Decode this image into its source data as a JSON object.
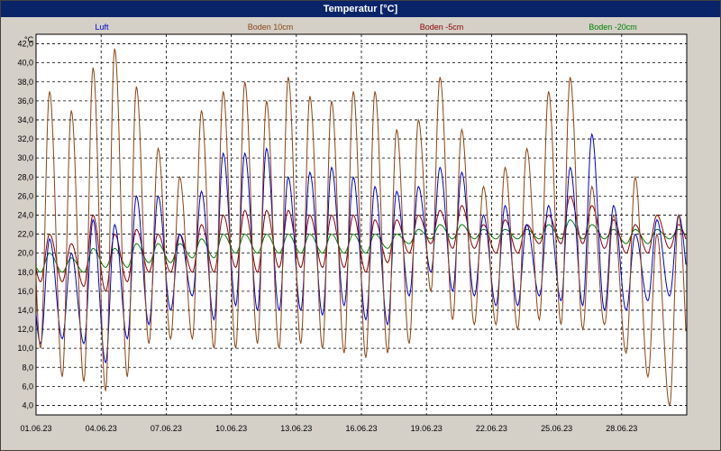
{
  "window": {
    "title": "Temperatur [°C]"
  },
  "chart_data": {
    "type": "line",
    "title": "Temperatur [°C]",
    "ylabel": "°C",
    "xlabel": "",
    "ylim": [
      3.0,
      43.0
    ],
    "y_ticks": [
      4.0,
      6.0,
      8.0,
      10.0,
      12.0,
      14.0,
      16.0,
      18.0,
      20.0,
      22.0,
      24.0,
      26.0,
      28.0,
      30.0,
      32.0,
      34.0,
      36.0,
      38.0,
      40.0,
      42.0
    ],
    "x_range": [
      "01.06.23",
      "30.06.23"
    ],
    "x_ticks": [
      "01.06.23",
      "04.06.23",
      "07.06.23",
      "10.06.23",
      "13.06.23",
      "16.06.23",
      "19.06.23",
      "22.06.23",
      "25.06.23",
      "28.06.23"
    ],
    "grid": true,
    "legend_placement": "top",
    "series": [
      {
        "name": "Luft",
        "color": "#0000cc",
        "daily_min": [
          10.5,
          11.0,
          10.5,
          8.5,
          11.0,
          12.5,
          14.0,
          15.5,
          13.0,
          14.5,
          14.0,
          14.0,
          14.0,
          13.5,
          14.5,
          13.0,
          12.5,
          15.5,
          18.0,
          16.0,
          15.5,
          14.5,
          14.5,
          15.5,
          15.0,
          14.5,
          14.0,
          14.0,
          15.0,
          15.5
        ],
        "daily_max": [
          21.5,
          20.0,
          23.5,
          23.0,
          26.0,
          26.0,
          22.0,
          26.5,
          30.5,
          30.5,
          31.0,
          28.0,
          28.5,
          29.0,
          28.0,
          27.0,
          26.5,
          27.0,
          29.0,
          28.5,
          24.0,
          25.0,
          23.0,
          25.0,
          29.0,
          32.5,
          25.0,
          22.0,
          23.5,
          24.0
        ]
      },
      {
        "name": "Boden 10cm",
        "color": "#8b4513",
        "daily_min": [
          10.0,
          7.0,
          6.5,
          5.5,
          7.0,
          10.5,
          11.0,
          11.0,
          10.0,
          10.0,
          10.5,
          10.0,
          10.5,
          10.0,
          9.5,
          9.0,
          9.5,
          10.5,
          16.0,
          13.0,
          12.5,
          12.5,
          12.0,
          13.0,
          12.5,
          12.0,
          12.5,
          9.5,
          7.0,
          4.0
        ],
        "daily_max": [
          37.0,
          35.0,
          39.5,
          41.5,
          37.5,
          31.0,
          28.0,
          35.0,
          37.0,
          38.0,
          36.0,
          38.5,
          36.5,
          36.0,
          37.0,
          37.0,
          33.0,
          34.0,
          38.5,
          33.0,
          27.0,
          29.0,
          31.0,
          37.0,
          38.5,
          27.0,
          24.0,
          28.0,
          22.0,
          24.0
        ]
      },
      {
        "name": "Boden -5cm",
        "color": "#8b0000",
        "daily_min": [
          17.0,
          17.0,
          16.5,
          16.0,
          17.0,
          18.0,
          18.0,
          18.0,
          18.0,
          18.5,
          18.0,
          18.5,
          18.5,
          18.5,
          18.5,
          18.0,
          19.0,
          20.0,
          21.0,
          20.5,
          20.5,
          20.0,
          20.0,
          21.0,
          21.0,
          21.0,
          20.5,
          20.0,
          20.0,
          20.5
        ],
        "daily_max": [
          22.0,
          21.0,
          24.0,
          22.0,
          22.5,
          22.0,
          22.0,
          23.0,
          24.0,
          24.5,
          24.5,
          24.5,
          24.0,
          24.0,
          24.0,
          23.5,
          23.5,
          24.0,
          24.5,
          25.0,
          23.0,
          23.5,
          23.0,
          24.0,
          26.0,
          25.0,
          23.5,
          23.0,
          24.0,
          23.0
        ]
      },
      {
        "name": "Boden -20cm",
        "color": "#008000",
        "daily_min": [
          18.0,
          18.0,
          18.0,
          18.5,
          18.5,
          19.0,
          19.0,
          19.5,
          19.5,
          20.0,
          20.0,
          20.0,
          20.0,
          20.0,
          20.0,
          20.0,
          20.5,
          21.0,
          21.5,
          21.5,
          21.5,
          21.5,
          21.5,
          21.5,
          21.5,
          21.5,
          21.5,
          21.0,
          21.0,
          21.5
        ],
        "daily_max": [
          20.0,
          19.5,
          20.5,
          20.5,
          21.0,
          21.0,
          21.0,
          21.5,
          22.0,
          22.0,
          22.0,
          22.0,
          22.0,
          22.0,
          22.0,
          22.0,
          22.0,
          22.5,
          23.0,
          23.0,
          22.5,
          22.5,
          22.5,
          23.0,
          23.5,
          23.0,
          22.5,
          22.5,
          22.5,
          22.5
        ]
      }
    ]
  }
}
